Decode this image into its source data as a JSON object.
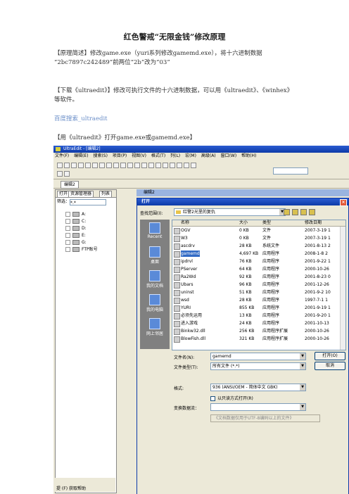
{
  "document": {
    "title": "红色警戒“无限金钱”修改原理",
    "para1_line1": "【原理简述】修改game.exe（yuri系列修改gamemd.exe），将十六进制数据",
    "para1_line2": "“2bc7897c242489”前两位“2b”改为“03”",
    "para2_line1": "【下载《ultraedit》】修改可执行文件的十六进制数据，可以用《ultraedit》、《winhex》",
    "para2_line2": "等软件。",
    "link_text": "百度搜索_ultraedit",
    "para3": "【用《ultraedit》打开game.exe或gamemd.exe】"
  },
  "screenshot": {
    "app_title": "UltraEdit - [编辑2]",
    "menu": [
      "文件(F)",
      "编辑(E)",
      "搜索(S)",
      "项目(P)",
      "视图(V)",
      "格式(T)",
      "列(L)",
      "宏(M)",
      "高级(A)",
      "窗口(W)",
      "帮助(H)"
    ],
    "doc_tab": "编辑2",
    "left_pane": {
      "tabs": [
        "打开",
        "资源管理器",
        "列表"
      ],
      "filter_label": "筛选：",
      "filter_value": "*.*",
      "drives": [
        "A:",
        "C:",
        "D:",
        "E:",
        "G:",
        "FTP账号"
      ],
      "bottom_tab": "提 (F) 获取帮助"
    },
    "doc_window_title": "编辑2",
    "dialog": {
      "title": "打开",
      "close": "×",
      "lookin_label": "查找范围(I):",
      "lookin_value": "红警2光里的复仇",
      "places": [
        "Recent",
        "桌面",
        "我的文档",
        "我的电脑",
        "网上邻居"
      ],
      "columns": [
        "名称",
        "大小",
        "类型",
        "修改日期"
      ],
      "files": [
        {
          "name": "OGV",
          "size": "0 KB",
          "type": "文件",
          "date": "2007-3-19 1"
        },
        {
          "name": "W3",
          "size": "0 KB",
          "type": "文件",
          "date": "2007-3-19 1"
        },
        {
          "name": "ascdrv",
          "size": "28 KB",
          "type": "系统文件",
          "date": "2001-8-13 2"
        },
        {
          "name": "gamemd",
          "size": "4,697 KB",
          "type": "应用程序",
          "date": "2008-1-8 2",
          "selected": true
        },
        {
          "name": "ipdrvl",
          "size": "76 KB",
          "type": "应用程序",
          "date": "2001-9-22 1"
        },
        {
          "name": "PServer",
          "size": "64 KB",
          "type": "应用程序",
          "date": "2000-10-26"
        },
        {
          "name": "Ra2Wd",
          "size": "92 KB",
          "type": "应用程序",
          "date": "2001-8-23 0"
        },
        {
          "name": "Ubars",
          "size": "96 KB",
          "type": "应用程序",
          "date": "2001-12-26"
        },
        {
          "name": "uninst",
          "size": "51 KB",
          "type": "应用程序",
          "date": "2001-9-2 10"
        },
        {
          "name": "wsd",
          "size": "28 KB",
          "type": "应用程序",
          "date": "1997-7-1 1"
        },
        {
          "name": "YURI",
          "size": "855 KB",
          "type": "应用程序",
          "date": "2001-9-19 1"
        },
        {
          "name": "必须先运用",
          "size": "13 KB",
          "type": "应用程序",
          "date": "2001-9-20 1"
        },
        {
          "name": "进入游戏",
          "size": "24 KB",
          "type": "应用程序",
          "date": "2001-10-13"
        },
        {
          "name": "Binkw32.dll",
          "size": "256 KB",
          "type": "应用程序扩展",
          "date": "2000-10-26"
        },
        {
          "name": "BlowFish.dll",
          "size": "321 KB",
          "type": "应用程序扩展",
          "date": "2000-10-26"
        }
      ],
      "filename_label": "文件名(N):",
      "filename_value": "gamemd",
      "filetype_label": "文件类型(T):",
      "filetype_value": "所有文件 (*.*)",
      "open_button": "打开(O)",
      "cancel_button": "取消",
      "format_label": "格式:",
      "format_value": "936 (ANSI/OEM - 简体中文 GBK)",
      "readonly_label": "以只读方式打开(R)",
      "conversion_label": "变换数据流：",
      "conversion_hint": "《文档数据仅用于UTF-8编码以上的文件》"
    }
  }
}
